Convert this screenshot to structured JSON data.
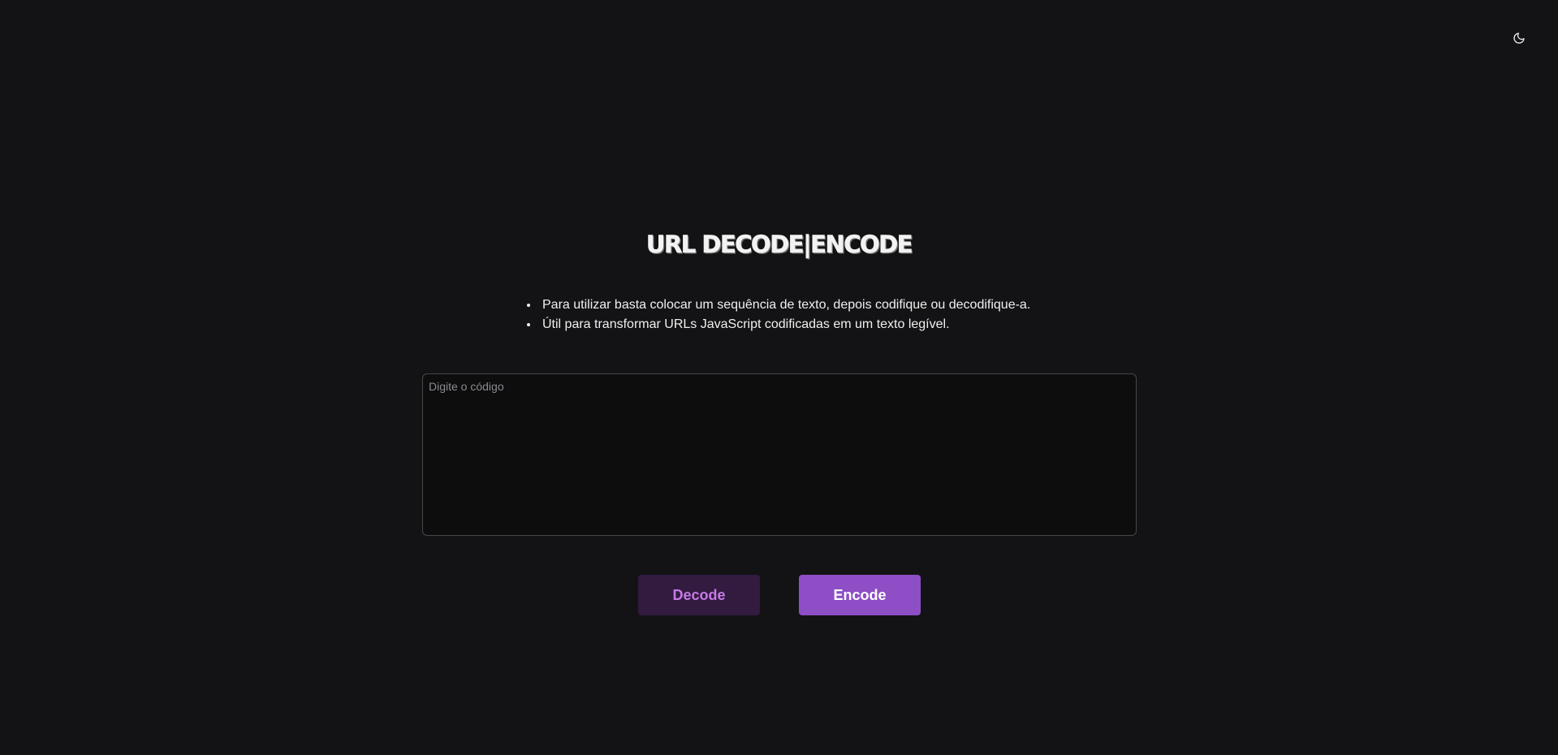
{
  "header": {
    "theme_toggle_icon": "moon-icon"
  },
  "main": {
    "title": "URL DECODE|ENCODE",
    "instructions": [
      "Para utilizar basta colocar um sequência de texto, depois codifique ou decodifique-a.",
      "Útil para transformar URLs JavaScript codificadas em um texto legível."
    ],
    "input": {
      "value": "",
      "placeholder": "Digite o código"
    },
    "buttons": {
      "decode_label": "Decode",
      "encode_label": "Encode"
    }
  },
  "colors": {
    "background": "#131315",
    "input_background": "#0d0d0e",
    "input_border": "#47474b",
    "decode_bg": "#321b3f",
    "decode_text": "#c57ae8",
    "encode_bg": "#8e4ec6",
    "encode_text": "#ffffff"
  }
}
